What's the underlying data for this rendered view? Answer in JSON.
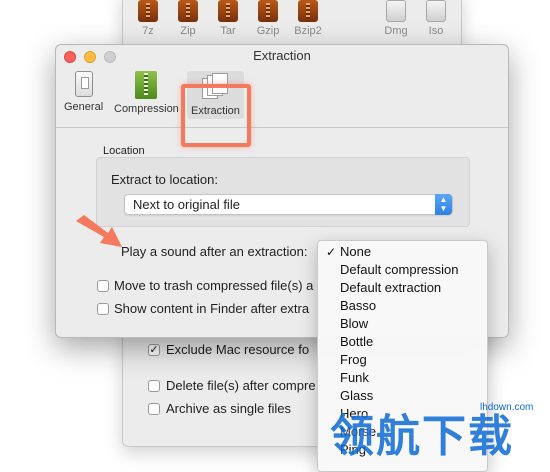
{
  "background_window": {
    "formats": [
      "7z",
      "Zip",
      "Tar",
      "Gzip",
      "Bzip2",
      "Dmg",
      "Iso"
    ],
    "checks": [
      {
        "label": "Exclude Mac resource fo",
        "checked": true
      },
      {
        "label": "Delete file(s) after compre",
        "checked": false
      },
      {
        "label": "Archive as single files",
        "checked": false
      }
    ]
  },
  "window": {
    "title": "Extraction",
    "toolbar": {
      "general": "General",
      "compression": "Compression",
      "extraction": "Extraction"
    },
    "location_section": "Location",
    "extract_to_label": "Extract to location:",
    "extract_to_value": "Next to original file",
    "sound_label": "Play a sound after an extraction:",
    "checks": [
      {
        "label": "Move to trash compressed file(s) a",
        "checked": false
      },
      {
        "label": "Show content in Finder after extra",
        "checked": false
      }
    ]
  },
  "sound_menu": {
    "selected": "None",
    "items": [
      "None",
      "Default compression",
      "Default extraction",
      "Basso",
      "Blow",
      "Bottle",
      "Frog",
      "Funk",
      "Glass",
      "Hero",
      "Morse",
      "Ping"
    ]
  },
  "watermark": {
    "text": "领航下载",
    "url": "lhdown.com"
  },
  "colors": {
    "highlight": "#f4795d",
    "accent": "#2f7fe6",
    "watermark": "#0c6ad6"
  }
}
